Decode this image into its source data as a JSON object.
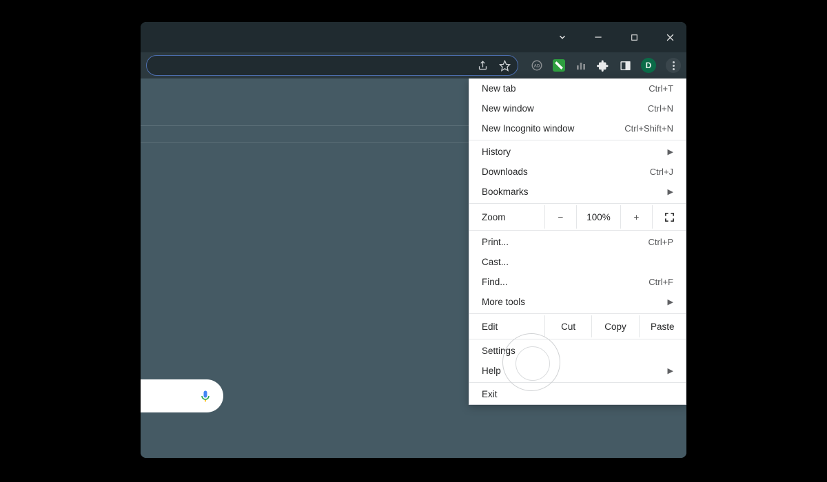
{
  "titlebar": {
    "profile_letter": "D"
  },
  "menu": {
    "group1": [
      {
        "label": "New tab",
        "shortcut": "Ctrl+T"
      },
      {
        "label": "New window",
        "shortcut": "Ctrl+N"
      },
      {
        "label": "New Incognito window",
        "shortcut": "Ctrl+Shift+N"
      }
    ],
    "group2": [
      {
        "label": "History",
        "submenu": true
      },
      {
        "label": "Downloads",
        "shortcut": "Ctrl+J"
      },
      {
        "label": "Bookmarks",
        "submenu": true
      }
    ],
    "zoom": {
      "label": "Zoom",
      "minus": "−",
      "value": "100%",
      "plus": "+"
    },
    "group3": [
      {
        "label": "Print...",
        "shortcut": "Ctrl+P"
      },
      {
        "label": "Cast..."
      },
      {
        "label": "Find...",
        "shortcut": "Ctrl+F"
      },
      {
        "label": "More tools",
        "submenu": true
      }
    ],
    "edit": {
      "label": "Edit",
      "cut": "Cut",
      "copy": "Copy",
      "paste": "Paste"
    },
    "group4": [
      {
        "label": "Settings"
      },
      {
        "label": "Help",
        "submenu": true
      }
    ],
    "group5": [
      {
        "label": "Exit"
      }
    ]
  }
}
